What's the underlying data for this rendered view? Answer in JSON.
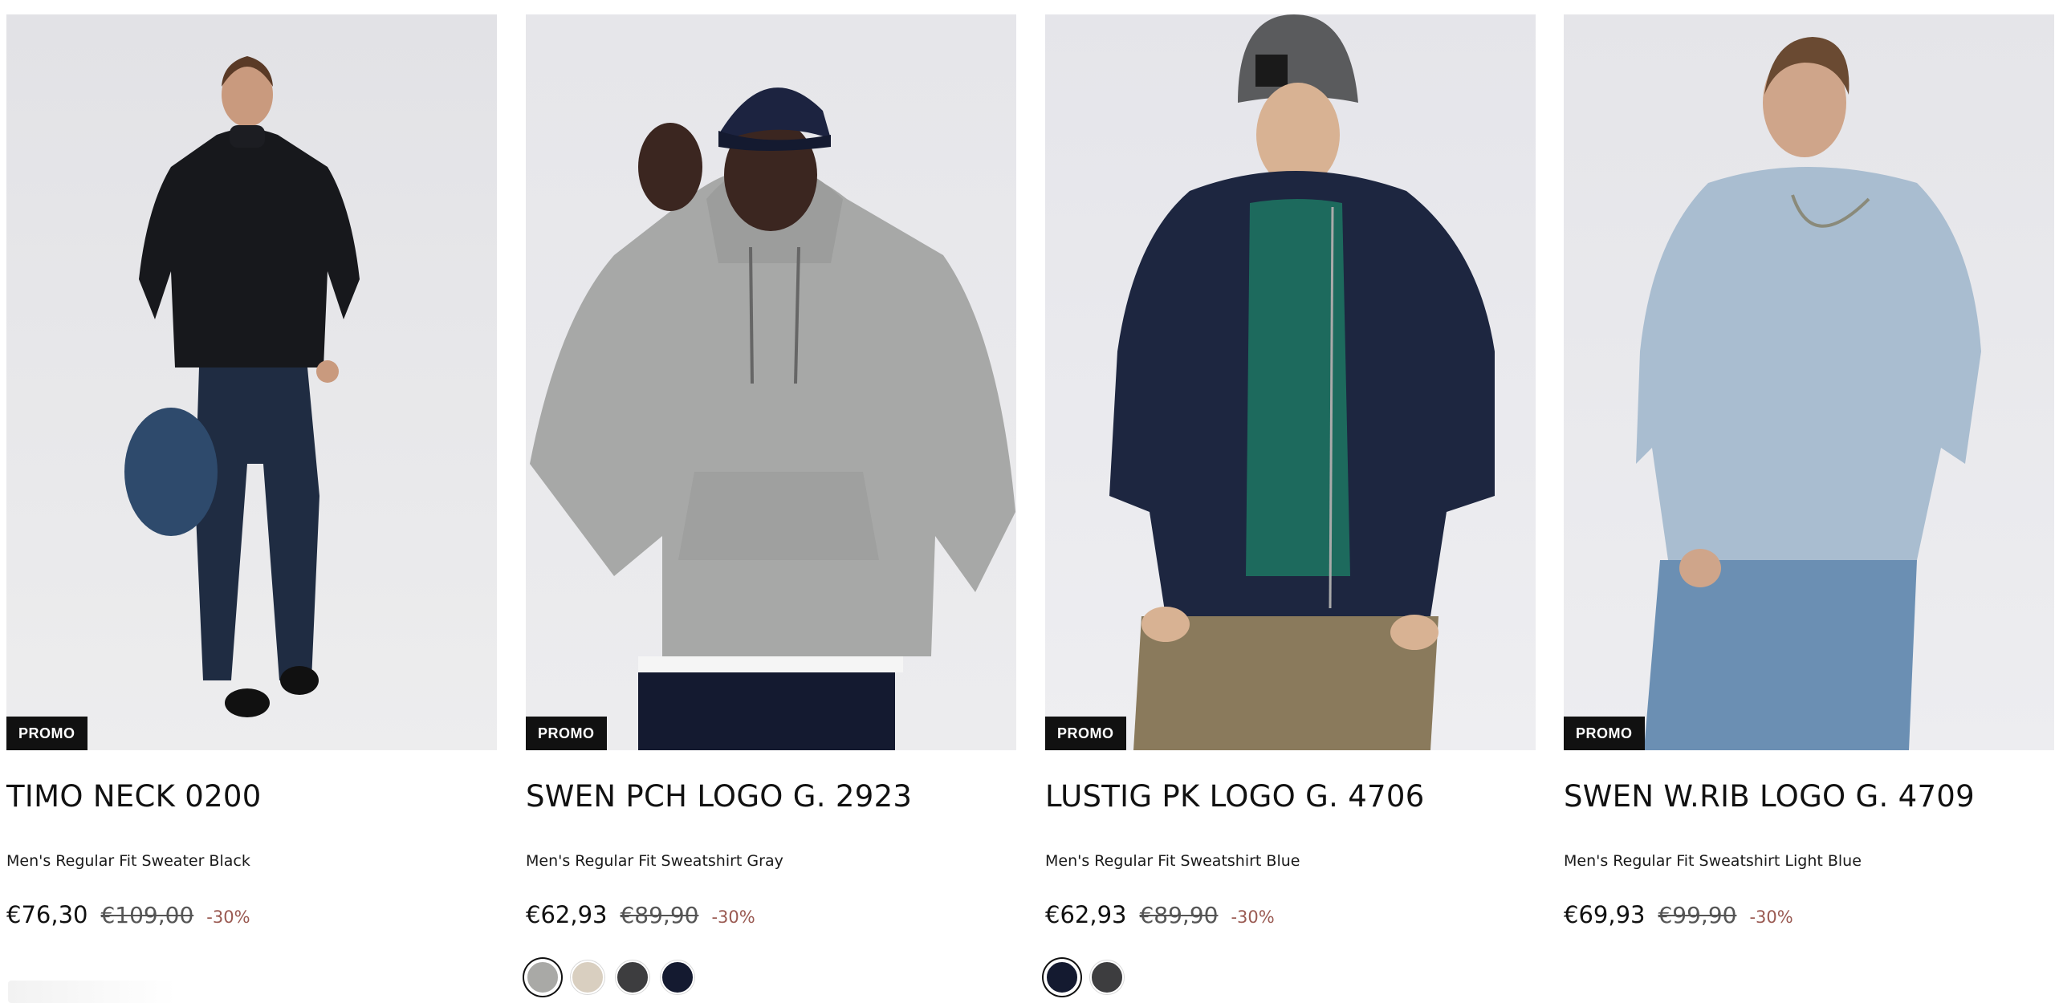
{
  "products": [
    {
      "badge": "PROMO",
      "name": "TIMO NECK 0200",
      "description": "Men's Regular Fit Sweater Black",
      "price": "€76,30",
      "old_price": "€109,00",
      "discount": "-30%",
      "image": "model-black-turtleneck-sweater-dark-jeans",
      "swatches": []
    },
    {
      "badge": "PROMO",
      "name": "SWEN PCH LOGO G. 2923",
      "description": "Men's Regular Fit Sweatshirt Gray",
      "price": "€62,93",
      "old_price": "€89,90",
      "discount": "-30%",
      "image": "model-gray-hoodie-navy-cap",
      "swatches": [
        {
          "color": "#a9a9a6",
          "selected": true
        },
        {
          "color": "#d9cfc0",
          "selected": false
        },
        {
          "color": "#3d3d3f",
          "selected": false
        },
        {
          "color": "#141a30",
          "selected": false
        }
      ]
    },
    {
      "badge": "PROMO",
      "name": "LUSTIG PK LOGO G. 4706",
      "description": "Men's Regular Fit Sweatshirt Blue",
      "price": "€62,93",
      "old_price": "€89,90",
      "discount": "-30%",
      "image": "model-navy-zip-sweatshirt-gray-beanie",
      "swatches": [
        {
          "color": "#141a30",
          "selected": true
        },
        {
          "color": "#3d3d3f",
          "selected": false
        }
      ]
    },
    {
      "badge": "PROMO",
      "name": "SWEN W.RIB LOGO G. 4709",
      "description": "Men's Regular Fit Sweatshirt Light Blue",
      "price": "€69,93",
      "old_price": "€99,90",
      "discount": "-30%",
      "image": "model-light-blue-sweatshirt-jeans",
      "swatches": []
    }
  ],
  "colors": {
    "accent_discount": "#9a5a52",
    "badge_bg": "#111111"
  }
}
